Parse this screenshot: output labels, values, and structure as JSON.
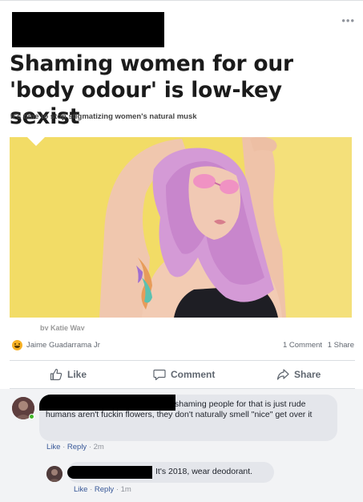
{
  "post": {
    "more_icon": "ellipsis-icon",
    "article": {
      "headline": "Shaming women for our 'body odour' is low-key sexist",
      "subheadline": "It's time to stop stigmatizing women's natural musk",
      "byline": "by Katie Way"
    },
    "reactions": {
      "icon": "haha-reaction-icon",
      "reactor": "Jaime Guadarrama Jr",
      "comments": "1 Comment",
      "shares": "1 Share"
    },
    "actions": {
      "like": "Like",
      "comment": "Comment",
      "share": "Share"
    }
  },
  "comments": [
    {
      "text": "shaming people for that is just rude humans aren't fuckin flowers, they don't naturally smell \"nice\" get over it",
      "like": "Like",
      "reply": "Reply",
      "time": "2m"
    },
    {
      "text": "It's 2018, wear deodorant.",
      "like": "Like",
      "reply": "Reply",
      "time": "1m"
    }
  ],
  "colors": {
    "link": "#385898",
    "photo_background": "#f2dc66",
    "hair": "#d49ad6",
    "online": "#42b72a"
  }
}
